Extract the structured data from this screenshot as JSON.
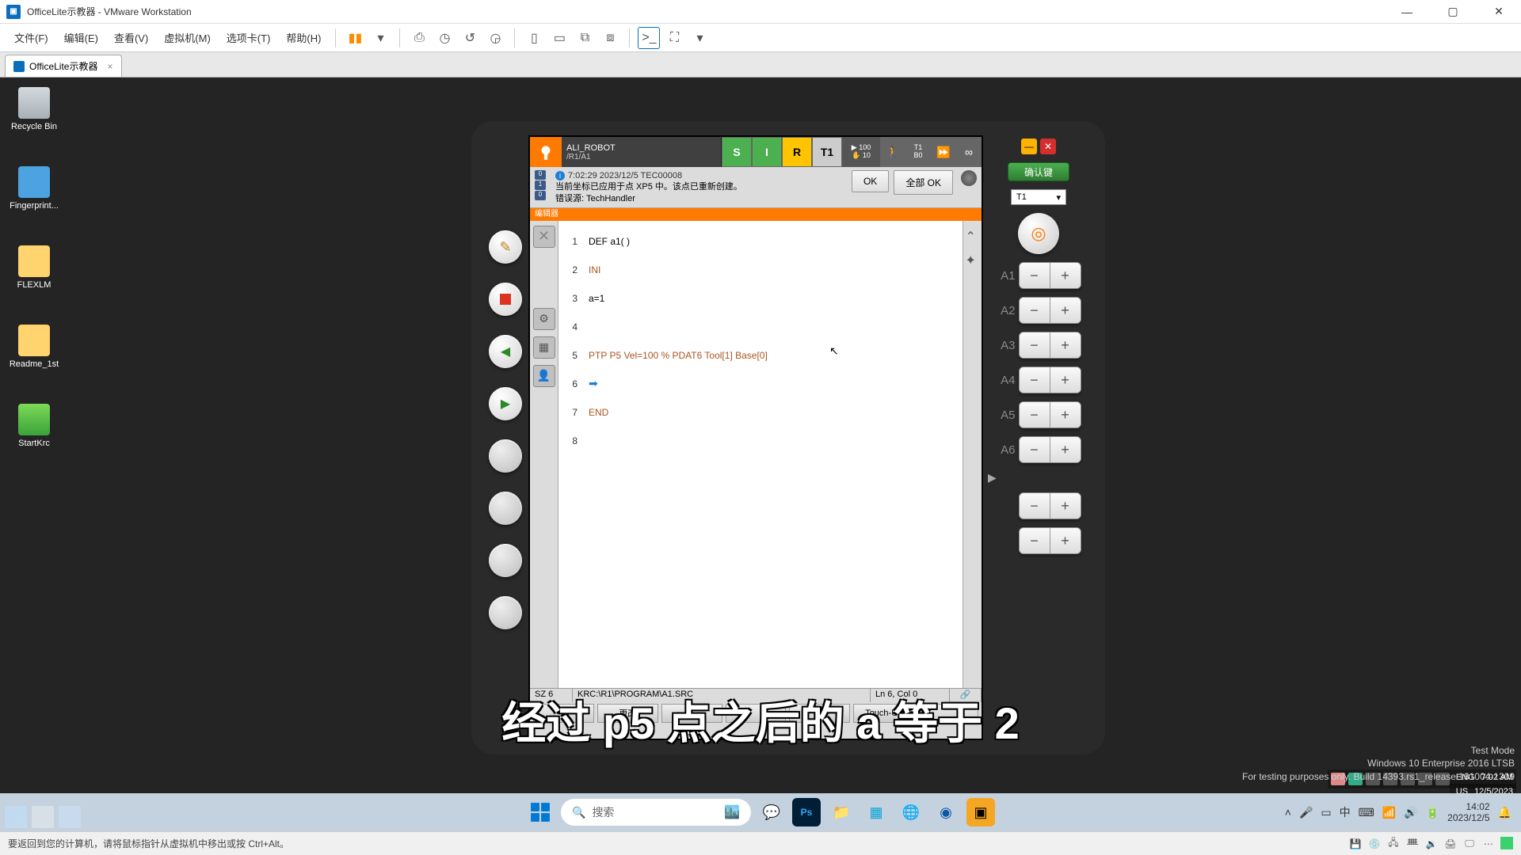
{
  "vmware": {
    "title": "OfficeLite示教器 - VMware Workstation",
    "menu": {
      "file": "文件(F)",
      "edit": "编辑(E)",
      "view": "查看(V)",
      "vm": "虚拟机(M)",
      "tabs": "选项卡(T)",
      "help": "帮助(H)"
    },
    "tab_name": "OfficeLite示教器",
    "status_hint": "要返回到您的计算机，请将鼠标指针从虚拟机中移出或按 Ctrl+Alt。"
  },
  "desktop": {
    "icons": [
      {
        "label": "Recycle Bin"
      },
      {
        "label": "Fingerprint..."
      },
      {
        "label": "FLEXLM"
      },
      {
        "label": "Readme_1st"
      },
      {
        "label": "StartKrc"
      }
    ],
    "watermark": {
      "l1": "Test Mode",
      "l2": "Windows 10 Enterprise 2016 LTSB",
      "l3": "For testing purposes only. Build 14393.rs1_release.181004-1309"
    }
  },
  "pad": {
    "robot": "ALI_ROBOT",
    "path": "/R1/A1",
    "modes": {
      "s": "S",
      "i": "I",
      "r": "R",
      "t1": "T1"
    },
    "speed_top": "100",
    "speed_bot": "10",
    "tool_top": "T1",
    "tool_bot": "B0",
    "msg_ts": "7:02:29 2023/12/5 TEC00008",
    "msg_line2": "当前坐标已应用于点 XP5 中。该点已重新创建。",
    "msg_src": "错误源: TechHandler",
    "btn_ok": "OK",
    "btn_all_ok": "全部 OK",
    "editor_tab": "编辑器",
    "code": {
      "l1_n": "1",
      "l1": "DEF a1( )",
      "l2_n": "2",
      "l2": "INI",
      "l3_n": "3",
      "l3": "a=1",
      "l4_n": "4",
      "l5_n": "5",
      "l5": "PTP P5 Vel=100 % PDAT6 Tool[1] Base[0]",
      "l6_n": "6",
      "l7_n": "7",
      "l7": "END",
      "l8_n": "8"
    },
    "status": {
      "sz": "SZ 6",
      "prog": "KRC:\\R1\\PROGRAM\\A1.SRC",
      "pos": "Ln 6, Col 0"
    },
    "softkeys": [
      "",
      "更改",
      "",
      "",
      "",
      "Touch-Up",
      ""
    ],
    "confirm": "确认键",
    "t1_select": "T1",
    "axes": [
      "A1",
      "A2",
      "A3",
      "A4",
      "A5",
      "A6"
    ]
  },
  "subtitle": "经过 p5 点之后的 a 等于 2",
  "taskbar": {
    "search_placeholder": "搜索",
    "lang1": "ENG",
    "lang2": "US",
    "time": "7:02 AM",
    "date": "12/5/2023",
    "host_time": "14:02",
    "host_date": "2023/12/5",
    "ime": "中"
  }
}
